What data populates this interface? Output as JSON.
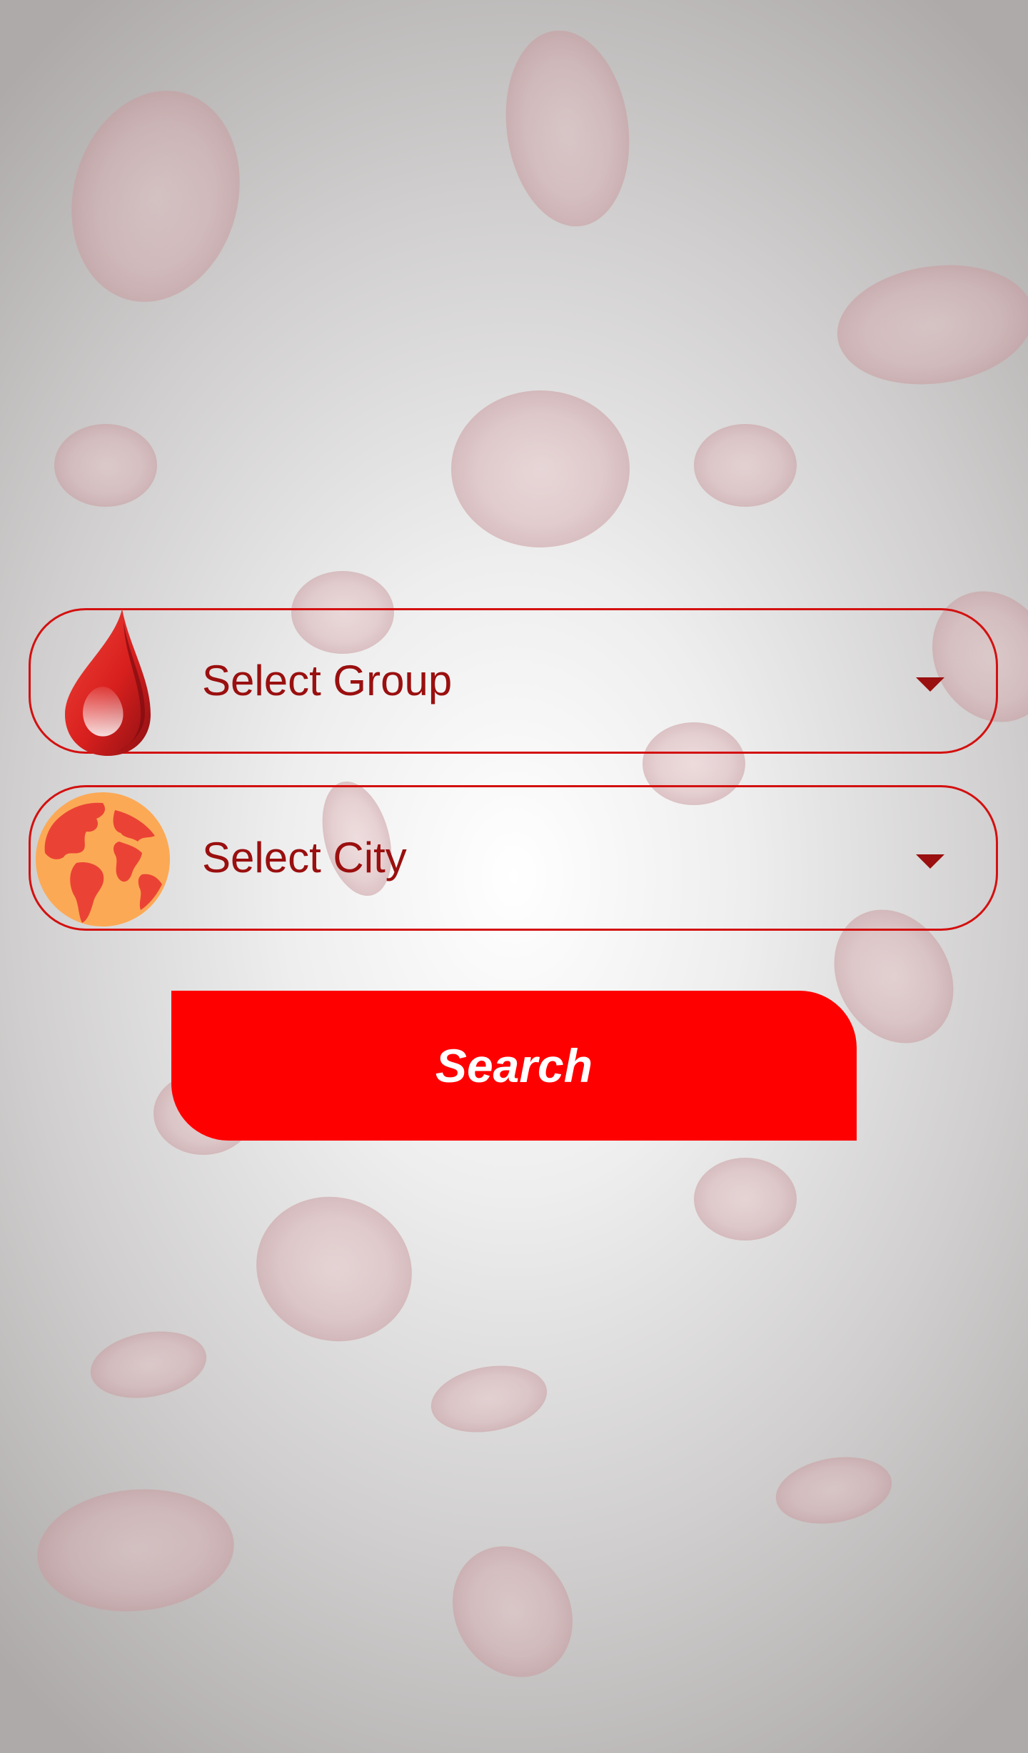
{
  "form": {
    "group_select": {
      "value": "Select Group",
      "icon": "blood-drop-icon"
    },
    "city_select": {
      "value": "Select City",
      "icon": "globe-icon"
    },
    "search_button": {
      "label": "Search"
    }
  },
  "colors": {
    "accent": "#ff0000",
    "border": "#d31010",
    "text": "#9a0f0f",
    "button_text": "#ffffff"
  }
}
